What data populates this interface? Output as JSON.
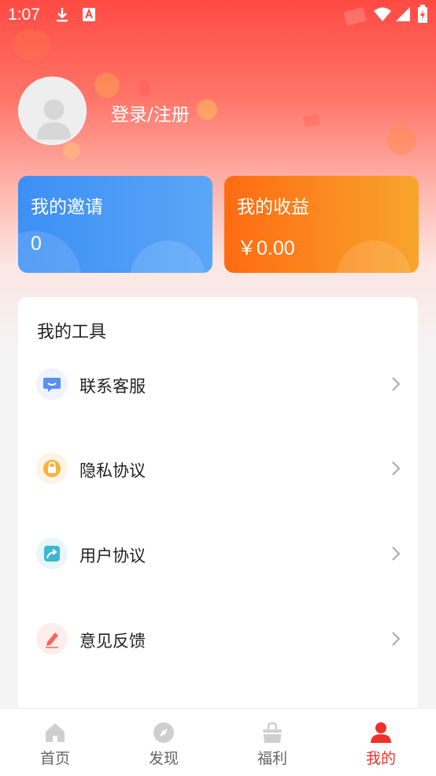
{
  "status_bar": {
    "time": "1:07"
  },
  "profile": {
    "login_text": "登录/注册"
  },
  "cards": {
    "invite": {
      "title": "我的邀请",
      "value": "0"
    },
    "income": {
      "title": "我的收益",
      "value": "￥0.00"
    }
  },
  "tools": {
    "title": "我的工具",
    "items": [
      {
        "label": "联系客服",
        "icon": "chat-icon",
        "color": "#5b8ff0"
      },
      {
        "label": "隐私协议",
        "icon": "lock-icon",
        "color": "#f6b33a"
      },
      {
        "label": "用户协议",
        "icon": "share-icon",
        "color": "#3fb7d4"
      },
      {
        "label": "意见反馈",
        "icon": "pen-icon",
        "color": "#f0685a"
      }
    ]
  },
  "bottom_nav": {
    "items": [
      {
        "label": "首页",
        "icon": "home-icon"
      },
      {
        "label": "发现",
        "icon": "compass-icon"
      },
      {
        "label": "福利",
        "icon": "bag-icon"
      },
      {
        "label": "我的",
        "icon": "user-icon",
        "active": true
      }
    ]
  },
  "colors": {
    "accent": "#f0302b",
    "invite_card": "#3d8ff5",
    "income_card": "#ff6b12"
  }
}
